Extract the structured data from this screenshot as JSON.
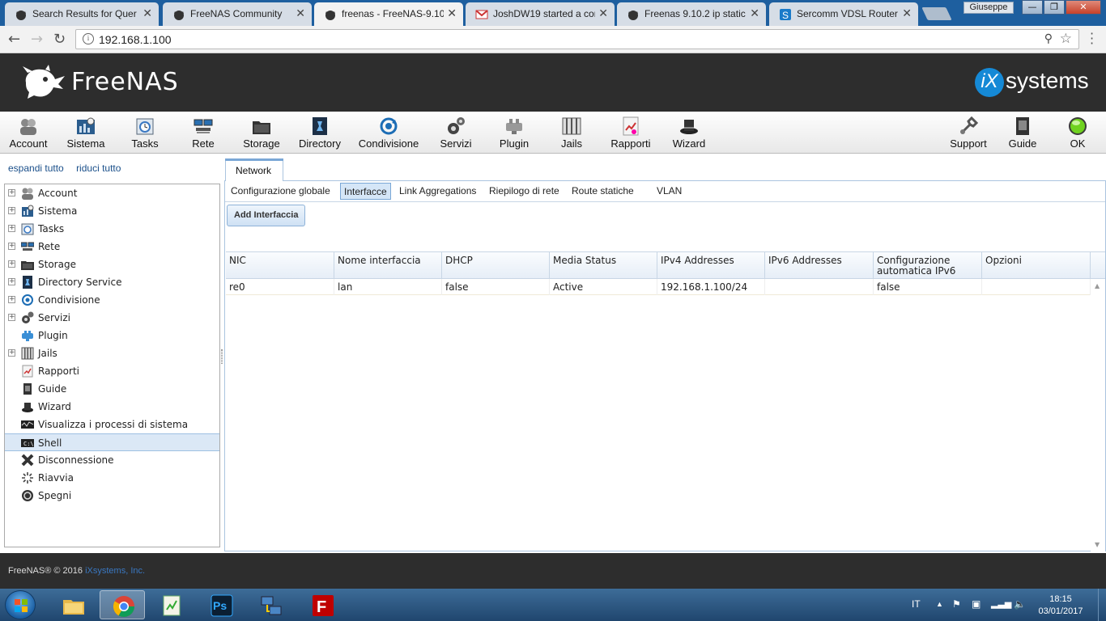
{
  "browser": {
    "tabs": [
      {
        "title": "Search Results for Quer",
        "icon": "freenas-devil-icon",
        "active": false
      },
      {
        "title": "FreeNAS Community",
        "icon": "freenas-devil-icon",
        "active": false
      },
      {
        "title": "freenas - FreeNAS-9.10",
        "icon": "freenas-devil-icon",
        "active": true
      },
      {
        "title": "JoshDW19 started a cor",
        "icon": "gmail-icon",
        "active": false
      },
      {
        "title": "Freenas 9.10.2 ip static",
        "icon": "freenas-devil-icon",
        "active": false
      },
      {
        "title": "Sercomm VDSL Router",
        "icon": "sercomm-icon",
        "active": false
      }
    ],
    "user": "Giuseppe",
    "url": "192.168.1.100"
  },
  "header": {
    "logo_text": "FreeNAS",
    "vendor_logo_i": "iX",
    "vendor_logo_text": "systems"
  },
  "toolbar": {
    "items": [
      {
        "label": "Account",
        "icon": "account-icon"
      },
      {
        "label": "Sistema",
        "icon": "sistema-icon"
      },
      {
        "label": "Tasks",
        "icon": "tasks-icon"
      },
      {
        "label": "Rete",
        "icon": "rete-icon"
      },
      {
        "label": "Storage",
        "icon": "storage-icon"
      },
      {
        "label": "Directory",
        "icon": "directory-icon"
      },
      {
        "label": "Condivisione",
        "icon": "condivisione-icon"
      },
      {
        "label": "Servizi",
        "icon": "servizi-icon"
      },
      {
        "label": "Plugin",
        "icon": "plugin-icon"
      },
      {
        "label": "Jails",
        "icon": "jails-icon"
      },
      {
        "label": "Rapporti",
        "icon": "rapporti-icon"
      },
      {
        "label": "Wizard",
        "icon": "wizard-icon"
      }
    ],
    "right_items": [
      {
        "label": "Support",
        "icon": "support-icon"
      },
      {
        "label": "Guide",
        "icon": "guide-icon"
      },
      {
        "label": "OK",
        "icon": "alert-ok-icon"
      }
    ]
  },
  "sidebar": {
    "expand_all": "espandi tutto",
    "collapse_all": "riduci tutto",
    "items": [
      {
        "label": "Account",
        "expandable": true
      },
      {
        "label": "Sistema",
        "expandable": true
      },
      {
        "label": "Tasks",
        "expandable": true
      },
      {
        "label": "Rete",
        "expandable": true
      },
      {
        "label": "Storage",
        "expandable": true
      },
      {
        "label": "Directory Service",
        "expandable": true
      },
      {
        "label": "Condivisione",
        "expandable": true
      },
      {
        "label": "Servizi",
        "expandable": true
      },
      {
        "label": "Plugin",
        "expandable": false
      },
      {
        "label": "Jails",
        "expandable": true
      },
      {
        "label": "Rapporti",
        "expandable": false
      },
      {
        "label": "Guide",
        "expandable": false
      },
      {
        "label": "Wizard",
        "expandable": false
      },
      {
        "label": "Visualizza i processi di sistema",
        "expandable": false
      },
      {
        "label": "Shell",
        "expandable": false,
        "selected": true
      },
      {
        "label": "Disconnessione",
        "expandable": false
      },
      {
        "label": "Riavvia",
        "expandable": false
      },
      {
        "label": "Spegni",
        "expandable": false
      }
    ]
  },
  "main": {
    "section_tab": "Network",
    "subtabs": [
      {
        "label": "Configurazione globale"
      },
      {
        "label": "Interfacce",
        "active": true
      },
      {
        "label": "Link Aggregations"
      },
      {
        "label": "Riepilogo di rete"
      },
      {
        "label": "Route statiche"
      },
      {
        "label": "VLAN"
      }
    ],
    "add_button": "Add Interfaccia",
    "table": {
      "columns": [
        "NIC",
        "Nome interfaccia",
        "DHCP",
        "Media Status",
        "IPv4 Addresses",
        "IPv6 Addresses",
        "Configurazione automatica IPv6",
        "Opzioni"
      ],
      "rows": [
        [
          "re0",
          "lan",
          "false",
          "Active",
          "192.168.1.100/24",
          "",
          "false",
          ""
        ]
      ]
    }
  },
  "footer": {
    "copyright": "FreeNAS® © 2016",
    "company": "iXsystems, Inc."
  },
  "taskbar": {
    "apps": [
      {
        "name": "file-explorer-icon"
      },
      {
        "name": "chrome-icon",
        "active": true
      },
      {
        "name": "notepad-plus-icon"
      },
      {
        "name": "photoshop-icon",
        "label": "Ps"
      },
      {
        "name": "network-tool-icon"
      },
      {
        "name": "filezilla-icon"
      }
    ],
    "language": "IT",
    "time": "18:15",
    "date": "03/01/2017"
  }
}
